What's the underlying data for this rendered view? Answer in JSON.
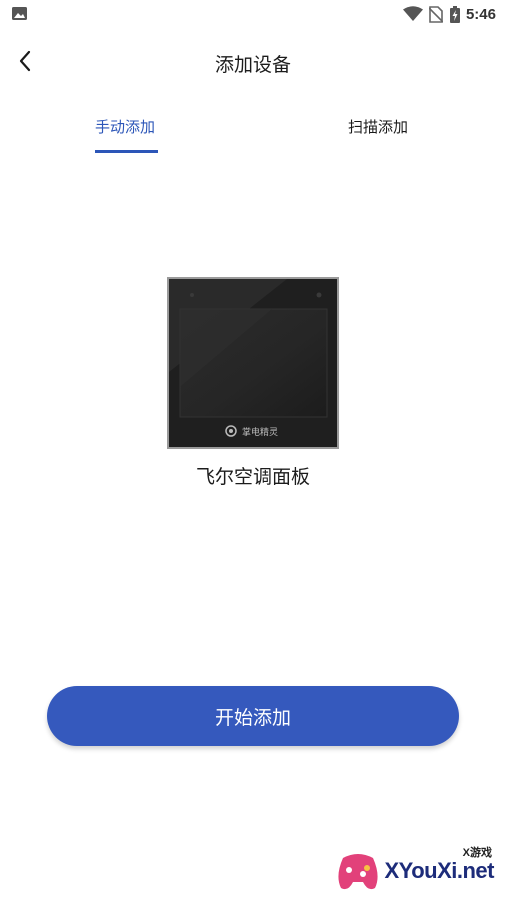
{
  "status_bar": {
    "time": "5:46",
    "icons": [
      "gallery-icon",
      "wifi-icon",
      "no-sim-icon",
      "battery-charging-icon"
    ]
  },
  "header": {
    "back_icon": "chevron-left-icon",
    "title": "添加设备"
  },
  "tabs": [
    {
      "label": "手动添加",
      "active": true
    },
    {
      "label": "扫描添加",
      "active": false
    }
  ],
  "device": {
    "name": "飞尔空调面板",
    "brand_text": "掌电精灵"
  },
  "start_button": {
    "label": "开始添加"
  },
  "watermark": {
    "main": "XYouXi.net",
    "sub": "X游戏"
  },
  "colors": {
    "accent": "#2c56b8",
    "button": "#3559bd",
    "background": "#ffffff"
  }
}
